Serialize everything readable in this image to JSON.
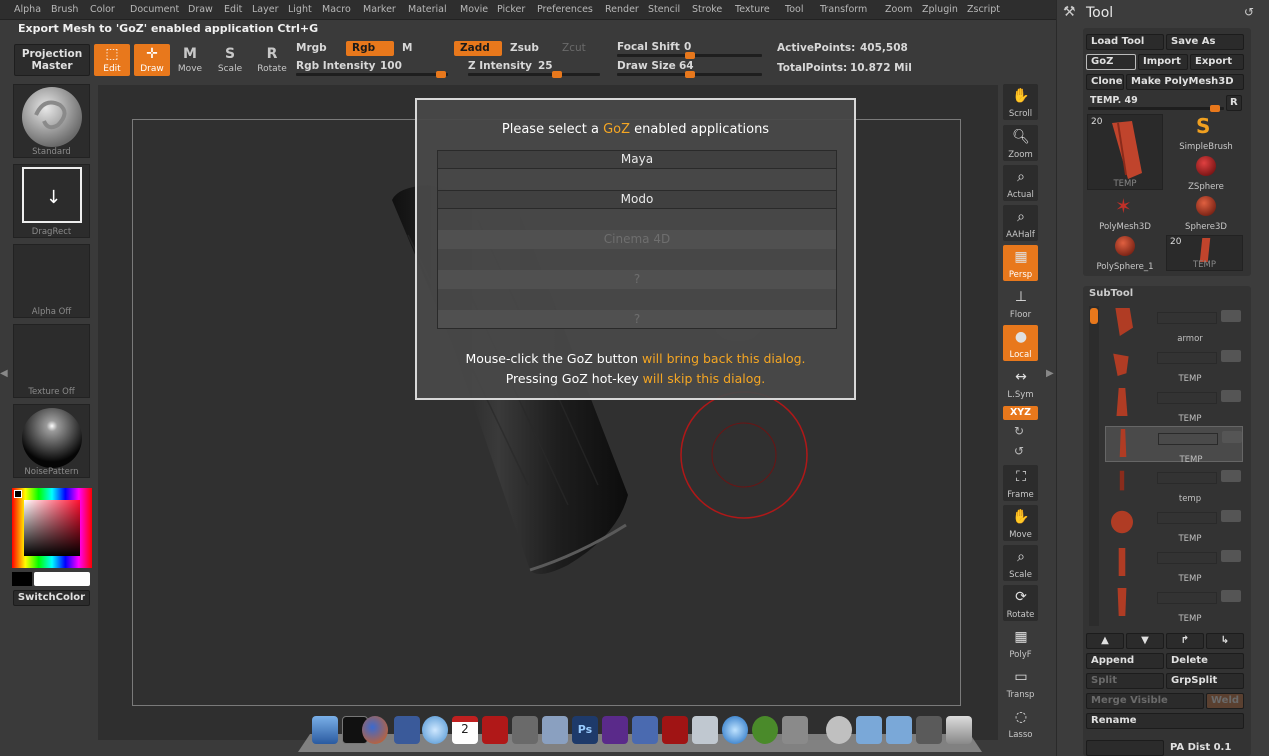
{
  "menu": [
    "Alpha",
    "Brush",
    "Color",
    "Document",
    "Draw",
    "Edit",
    "Layer",
    "Light",
    "Macro",
    "Marker",
    "Material",
    "Movie",
    "Picker",
    "Preferences",
    "Render",
    "Stencil",
    "Stroke",
    "Texture",
    "Tool",
    "Transform",
    "Zoom",
    "Zplugin",
    "Zscript"
  ],
  "title_line": "Export Mesh to 'GoZ' enabled application  Ctrl+G",
  "toolbar": {
    "projection_master": [
      "Projection",
      "Master"
    ],
    "edit": "Edit",
    "draw": "Draw",
    "move": "Move",
    "scale": "Scale",
    "rotate": "Rotate",
    "mrgb": "Mrgb",
    "rgb": "Rgb",
    "m": "M",
    "zadd": "Zadd",
    "zsub": "Zsub",
    "zcut": "Zcut",
    "rgb_intensity_label": "Rgb Intensity",
    "rgb_intensity_value": "100",
    "z_intensity_label": "Z Intensity",
    "z_intensity_value": "25",
    "focal_shift_label": "Focal Shift",
    "focal_shift_value": "0",
    "draw_size_label": "Draw Size",
    "draw_size_value": "64",
    "active_points_label": "ActivePoints:",
    "active_points_value": "405,508",
    "total_points_label": "TotalPoints:",
    "total_points_value": "10.872 Mil"
  },
  "left_shelf": {
    "standard": "Standard",
    "dragrect": "DragRect",
    "alpha_off": "Alpha  Off",
    "texture_off": "Texture  Off",
    "noise_pattern": "NoisePattern",
    "switch_color": "SwitchColor"
  },
  "right_shelf": [
    "Scroll",
    "Zoom",
    "Actual",
    "AAHalf",
    "Persp",
    "Floor",
    "Local",
    "L.Sym",
    "XYZ",
    "Frame",
    "Move",
    "Scale",
    "Rotate",
    "PolyF",
    "Transp",
    "Lasso"
  ],
  "tool_palette": {
    "title": "Tool",
    "load_tool": "Load Tool",
    "save_as": "Save As",
    "goz": "GoZ",
    "import": "Import",
    "export": "Export",
    "clone": "Clone",
    "make_polymesh": "Make PolyMesh3D",
    "temp_label": "TEMP. 49",
    "r": "R",
    "current_count": "20",
    "current_name": "TEMP",
    "items": [
      "SimpleBrush",
      "ZSphere",
      "PolyMesh3D",
      "Sphere3D",
      "PolySphere_1"
    ],
    "temp_thumb_count": "20",
    "temp_thumb_name": "TEMP",
    "subtool_title": "SubTool",
    "subtools": [
      "armor",
      "TEMP",
      "TEMP",
      "TEMP",
      "temp",
      "TEMP",
      "TEMP",
      "TEMP"
    ],
    "append": "Append",
    "delete": "Delete",
    "split": "Split",
    "grpsplit": "GrpSplit",
    "merge_visible": "Merge Visible",
    "weld": "Weld",
    "rename": "Rename",
    "pa_dist": "PA Dist 0.1"
  },
  "dialog": {
    "title_pre": "Please select a ",
    "title_goz": "GoZ",
    "title_post": " enabled applications",
    "apps": [
      "Maya",
      "Modo",
      "Cinema 4D",
      "?",
      "?"
    ],
    "note1_pre": "Mouse-click the GoZ button ",
    "note1_hl": "will bring back this dialog.",
    "note2_pre": "Pressing GoZ hot-key ",
    "note2_hl": "will skip this dialog."
  },
  "colors": {
    "accent": "#e8781c",
    "goz_highlight": "#f5a623",
    "brush_ring": "#b01818"
  }
}
